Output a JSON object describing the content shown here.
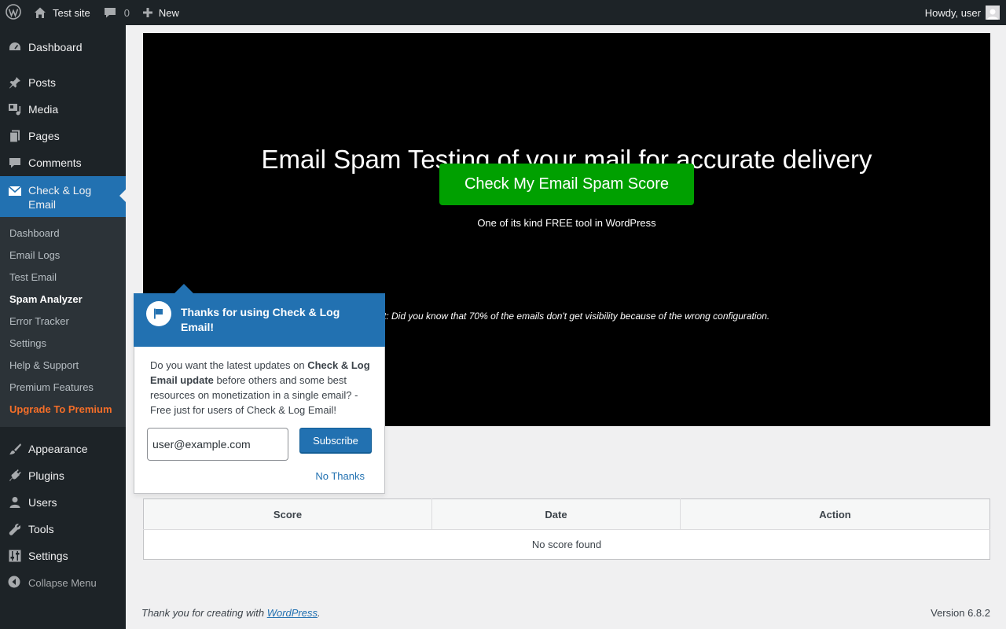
{
  "adminbar": {
    "site_name": "Test site",
    "comments_count": "0",
    "new_label": "New",
    "howdy": "Howdy, user"
  },
  "sidebar": {
    "dashboard": "Dashboard",
    "posts": "Posts",
    "media": "Media",
    "pages": "Pages",
    "comments": "Comments",
    "active_plugin": "Check & Log Email",
    "submenu": [
      "Dashboard",
      "Email Logs",
      "Test Email",
      "Spam Analyzer",
      "Error Tracker",
      "Settings",
      "Help & Support",
      "Premium Features",
      "Upgrade To Premium"
    ],
    "appearance": "Appearance",
    "plugins": "Plugins",
    "users": "Users",
    "tools": "Tools",
    "settings": "Settings",
    "collapse": "Collapse Menu"
  },
  "banner": {
    "title": "Email Spam Testing of your mail for accurate delivery",
    "button": "Check My Email Spam Score",
    "subtitle": "One of its kind FREE tool in WordPress",
    "fact": "ct: Did you know that 70% of the emails don't get visibility because of the wrong configuration."
  },
  "table": {
    "headers": [
      "Score",
      "Date",
      "Action"
    ],
    "empty": "No score found"
  },
  "footer": {
    "thanks_prefix": "Thank you for creating with ",
    "wordpress_link": "WordPress",
    "thanks_suffix": ".",
    "version": "Version 6.8.2"
  },
  "popup": {
    "title": "Thanks for using Check & Log Email!",
    "body_1": "Do you want the latest updates on ",
    "body_bold": "Check & Log Email update",
    "body_2": " before others and some best resources on monetization in a single email? - Free just for users of Check & Log Email!",
    "email_value": "user@example.com",
    "subscribe": "Subscribe",
    "no_thanks": "No Thanks"
  },
  "colors": {
    "admin_dark": "#1d2327",
    "accent_blue": "#2271b1",
    "banner_green": "#00a000",
    "premium_orange": "#f56e28"
  }
}
